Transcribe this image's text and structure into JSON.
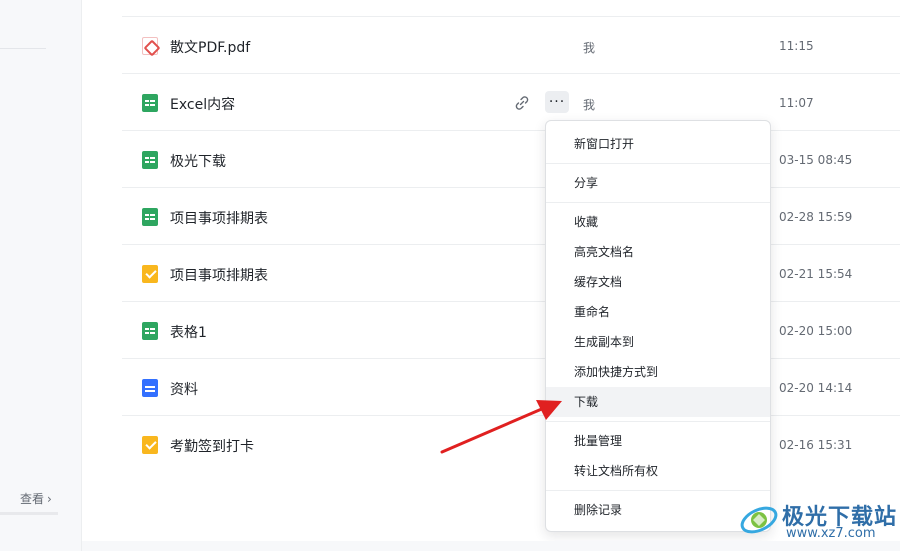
{
  "sidebar": {
    "view_more": "查看"
  },
  "files": [
    {
      "name": "散文PDF.pdf",
      "type": "pdf",
      "owner": "我",
      "time": "11:15"
    },
    {
      "name": "Excel内容",
      "type": "sheet",
      "owner": "我",
      "time": "11:07"
    },
    {
      "name": "极光下载",
      "type": "sheet",
      "owner": "",
      "time": "03-15 08:45"
    },
    {
      "name": "项目事项排期表",
      "type": "sheet",
      "owner": "",
      "time": "02-28 15:59"
    },
    {
      "name": "项目事项排期表",
      "type": "task",
      "owner": "",
      "time": "02-21 15:54"
    },
    {
      "name": "表格1",
      "type": "sheet",
      "owner": "",
      "time": "02-20 15:00"
    },
    {
      "name": "资料",
      "type": "doc",
      "owner": "",
      "time": "02-20 14:14"
    },
    {
      "name": "考勤签到打卡",
      "type": "task",
      "owner": "",
      "time": "02-16 15:31"
    }
  ],
  "row_actions": {
    "more": "···"
  },
  "menu": {
    "open_new_window": "新窗口打开",
    "share": "分享",
    "favorite": "收藏",
    "highlight_name": "高亮文档名",
    "cache_doc": "缓存文档",
    "rename": "重命名",
    "make_copy": "生成副本到",
    "add_shortcut": "添加快捷方式到",
    "download": "下载",
    "batch_manage": "批量管理",
    "transfer_ownership": "转让文档所有权",
    "delete_record": "删除记录"
  },
  "watermark": {
    "name": "极光下载站",
    "url": "www.xz7.com"
  },
  "colors": {
    "sheet": "#2ea660",
    "task": "#f9b71e",
    "doc": "#3370ff",
    "pdf": "#e2504d",
    "arrow": "#e02020"
  }
}
